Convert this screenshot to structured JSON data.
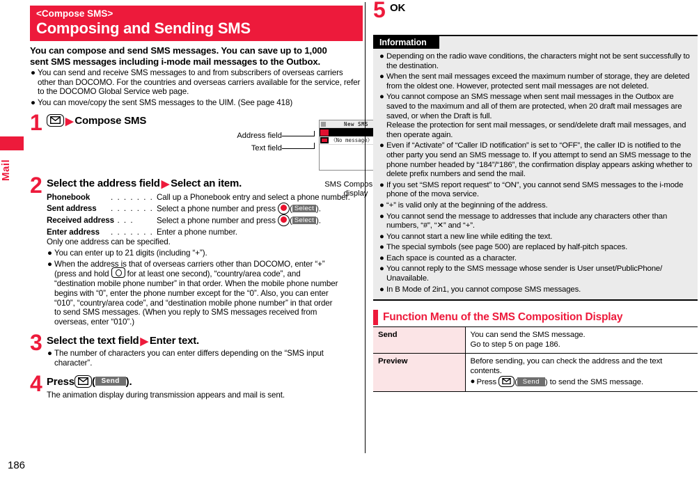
{
  "sidebar": {
    "tab_label": "Mail"
  },
  "page_number": "186",
  "header": {
    "subtitle": "<Compose SMS>",
    "title": "Composing and Sending SMS"
  },
  "intro": {
    "lead_line1": "You can compose and send SMS messages. You can save up to 1,000",
    "lead_line2": "sent SMS messages including i-mode mail messages to the Outbox.",
    "bullets": [
      "You can send and receive SMS messages to and from subscribers of overseas carriers other than DOCOMO. For the countries and overseas carriers available for the service, refer to the DOCOMO Global Service web page.",
      "You can move/copy the sent SMS messages to the UIM. (See page 418)"
    ]
  },
  "steps": {
    "step1": {
      "number": "1",
      "key_icon": "mail-key-icon",
      "arrow": "▶",
      "title": "Compose SMS"
    },
    "step2": {
      "number": "2",
      "title_a": "Select the address field",
      "arrow": "▶",
      "title_b": "Select an item.",
      "definitions": [
        {
          "term": "Phonebook",
          "dots": ". . . . . . . . .",
          "desc": "Call up a Phonebook entry and select a phone number.",
          "key": null
        },
        {
          "term": "Sent address",
          "dots": ". . . . . . . .",
          "desc_pre": "Select a phone number and press ",
          "key": "select-key-icon",
          "softkey": "Select",
          "desc_post": ")."
        },
        {
          "term": "Received address",
          "dots": ". . . .",
          "desc_pre": "Select a phone number and press ",
          "key": "select-key-icon",
          "softkey": "Select",
          "desc_post": ")."
        },
        {
          "term": "Enter address",
          "dots": ". . . . . . .",
          "desc": "Enter a phone number.",
          "key": null
        }
      ],
      "note": "Only one address can be specified.",
      "bullets": [
        "You can enter up to 21 digits (including “+”).",
        "When the address is that of overseas carriers other than DOCOMO, enter “+” (press and hold [0] for at least one second), “country/area code”, and “destination mobile phone number” in that order. When the mobile phone number begins with “0”, enter the phone number except for the “0”. Also, you can enter “010”, “country/area code”, and “destination mobile phone number” in that order to send SMS messages. (When you reply to SMS messages received from overseas, enter “010”.)"
      ],
      "bullet2_parts": {
        "p1": "When the address is that of overseas carriers other than DOCOMO, enter “+”",
        "p2_pre": "(press and hold ",
        "p2_post": " for at least one second), “country/area code”, and",
        "p3": "“destination mobile phone number” in that order. When the mobile phone number",
        "p4": "begins with “0”, enter the phone number except for the “0”. Also, you can enter",
        "p5": "“010”, “country/area code”, and “destination mobile phone number” in that order",
        "p6": "to send SMS messages. (When you reply to SMS messages received from",
        "p7": "overseas, enter “010”.)"
      }
    },
    "step3": {
      "number": "3",
      "title_a": "Select the text field",
      "arrow": "▶",
      "title_b": "Enter text.",
      "bullets": [
        "The number of characters you can enter differs depending on the “SMS input character”."
      ]
    },
    "step4": {
      "number": "4",
      "title_pre": "Press ",
      "key_icon": "mail-key-icon",
      "softkey": "Send",
      "title_post": ").",
      "note": "The animation display during transmission appears and mail is sent."
    },
    "step5": {
      "number": "5",
      "title": "OK"
    }
  },
  "phone_callout": {
    "screen": {
      "title": "New SMS",
      "address_field_value": "",
      "text_field_value": "〈No message〉"
    },
    "labels": {
      "address_field": "Address field",
      "text_field": "Text field",
      "caption_line1": "SMS Composition",
      "caption_line2": "display"
    }
  },
  "information": {
    "heading": "Information",
    "items": [
      "Depending on the radio wave conditions, the characters might not be sent successfully to the destination.",
      "When the sent mail messages exceed the maximum number of storage, they are deleted from the oldest one. However, protected sent mail messages are not deleted.",
      "You cannot compose an SMS message when sent mail messages in the Outbox are saved to the maximum and all of them are protected, when 20 draft mail messages are saved, or when the Draft is full.",
      "Even if “Activate” of “Caller ID notification” is set to “OFF”, the caller ID is notified to the other party you send an SMS message to. If you attempt to send an SMS message to the phone number headed by “184”/“186”, the confirmation display appears asking whether to delete prefix numbers and send the mail.",
      "If you set “SMS report request” to “ON”, you cannot send SMS messages to the i-mode phone of the mova service.",
      "“+” is valid only at the beginning of the address.",
      "You cannot send the message to addresses that include any characters other than numbers, “#”, “✕” and “+”.",
      "You cannot start a new line while editing the text.",
      "The special symbols (see page 500) are replaced by half-pitch spaces.",
      "Each space is counted as a character.",
      "You cannot reply to the SMS message whose sender is User unset/PublicPhone/ Unavailable.",
      "In B Mode of 2in1, you cannot compose SMS messages."
    ],
    "item3_continuation": "Release the protection for sent mail messages, or send/delete draft mail messages, and then operate again."
  },
  "function_menu": {
    "title": "Function Menu of the SMS Composition Display",
    "rows": [
      {
        "key": "Send",
        "line1": "You can send the SMS message.",
        "line2": "Go to step 5 on page 186."
      },
      {
        "key": "Preview",
        "line1": "Before sending, you can check the address and the text contents.",
        "sub_pre": "Press ",
        "sub_softkey": "Send",
        "sub_post": ") to send the SMS message."
      }
    ]
  },
  "colors": {
    "accent_red": "#ed1a3b",
    "key_red": "#e8112d",
    "info_bg": "#ebebeb",
    "fn_key_bg": "#fbe4e6",
    "softkey_gray": "#6f6f6f"
  }
}
